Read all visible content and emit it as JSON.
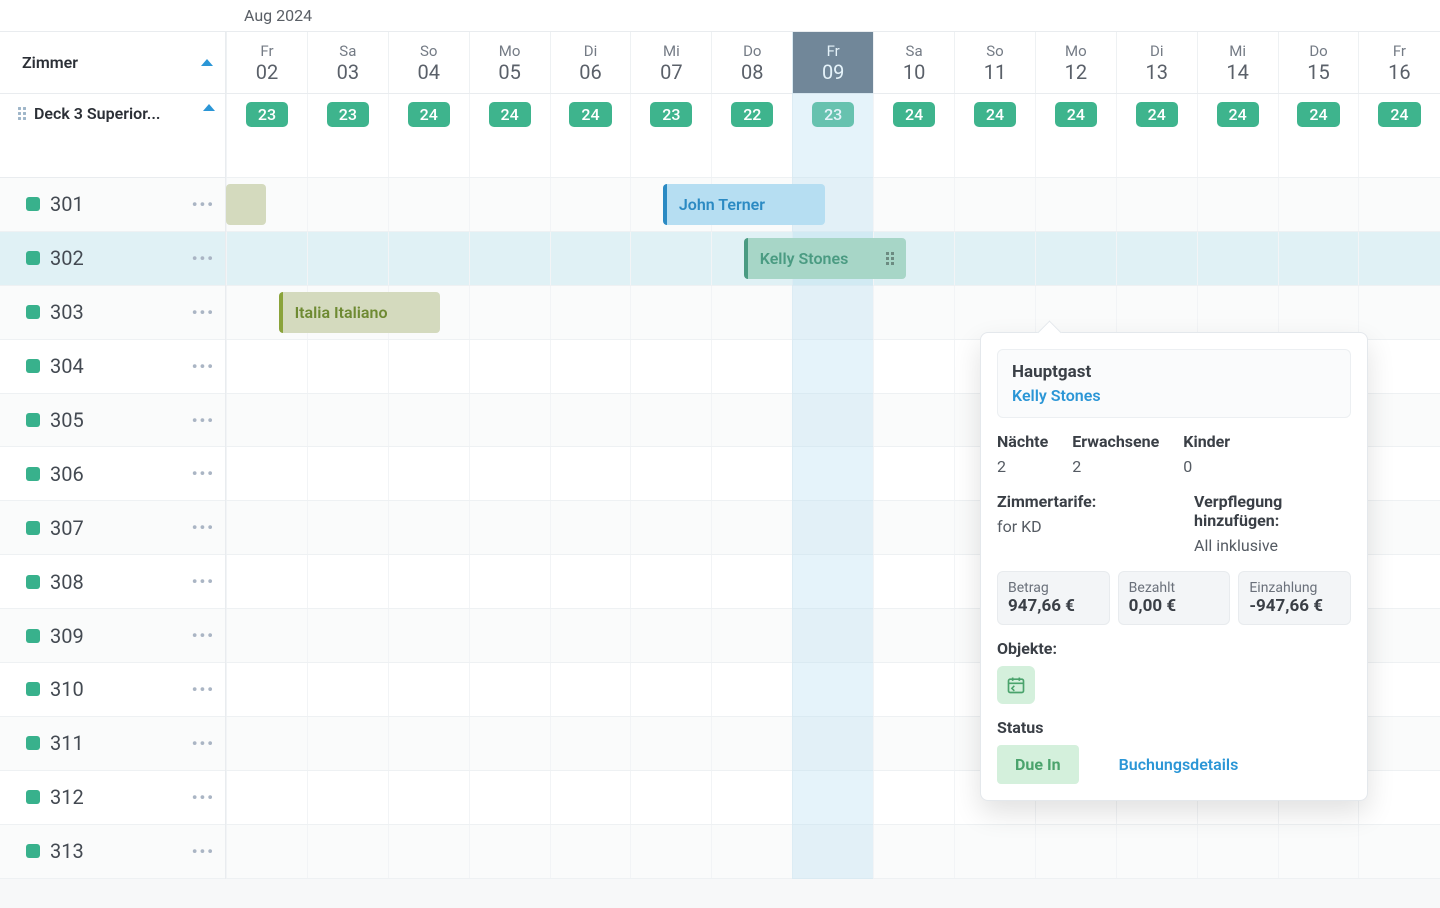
{
  "month_label": "Aug 2024",
  "sidebar": {
    "header_label": "Zimmer",
    "group_label": "Deck 3 Superior...",
    "rooms": [
      "301",
      "302",
      "303",
      "304",
      "305",
      "306",
      "307",
      "308",
      "309",
      "310",
      "311",
      "312",
      "313"
    ]
  },
  "dates": [
    {
      "dow": "Fr",
      "dom": "02"
    },
    {
      "dow": "Sa",
      "dom": "03"
    },
    {
      "dow": "So",
      "dom": "04"
    },
    {
      "dow": "Mo",
      "dom": "05"
    },
    {
      "dow": "Di",
      "dom": "06"
    },
    {
      "dow": "Mi",
      "dom": "07"
    },
    {
      "dow": "Do",
      "dom": "08"
    },
    {
      "dow": "Fr",
      "dom": "09",
      "today": true
    },
    {
      "dow": "Sa",
      "dom": "10"
    },
    {
      "dow": "So",
      "dom": "11"
    },
    {
      "dow": "Mo",
      "dom": "12"
    },
    {
      "dow": "Di",
      "dom": "13"
    },
    {
      "dow": "Mi",
      "dom": "14"
    },
    {
      "dow": "Do",
      "dom": "15"
    },
    {
      "dow": "Fr",
      "dom": "16"
    }
  ],
  "availability": [
    "23",
    "23",
    "24",
    "24",
    "24",
    "23",
    "22",
    "23",
    "24",
    "24",
    "24",
    "24",
    "24",
    "24",
    "24"
  ],
  "reservations": {
    "r301_stub": {
      "room_idx": 0,
      "class": "olive-stub",
      "left_cells": 0,
      "width_cells": 0.5,
      "label": ""
    },
    "r301_john": {
      "room_idx": 0,
      "class": "blue",
      "left_cells": 5.4,
      "width_cells": 2,
      "label": "John Terner"
    },
    "r302_kelly": {
      "room_idx": 1,
      "class": "green",
      "left_cells": 6.4,
      "width_cells": 2,
      "label": "Kelly Stones",
      "grip": true
    },
    "r303_italia": {
      "room_idx": 2,
      "class": "olive",
      "left_cells": 0.65,
      "width_cells": 2,
      "label": "Italia Italiano"
    }
  },
  "popover": {
    "main_guest_label": "Hauptgast",
    "main_guest_name": "Kelly Stones",
    "nights_label": "Nächte",
    "nights": "2",
    "adults_label": "Erwachsene",
    "adults": "2",
    "kids_label": "Kinder",
    "kids": "0",
    "rate_label": "Zimmertarife:",
    "rate_value": "for KD",
    "meal_label": "Verpflegung hinzufügen:",
    "meal_value": "All inklusive",
    "amount_label": "Betrag",
    "amount": "947,66 €",
    "paid_label": "Bezahlt",
    "paid": "0,00 €",
    "deposit_label": "Einzahlung",
    "deposit": "-947,66 €",
    "objects_label": "Objekte:",
    "status_label": "Status",
    "status_value": "Due In",
    "details_link": "Buchungsdetails"
  }
}
